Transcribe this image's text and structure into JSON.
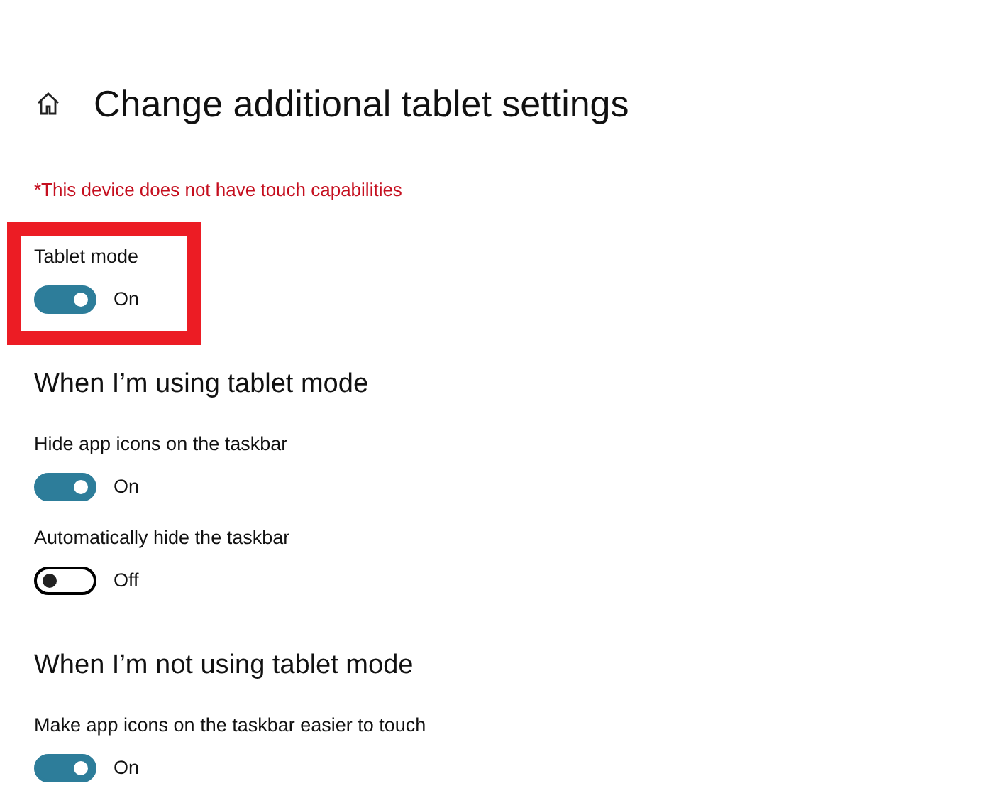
{
  "page": {
    "title": "Change additional tablet settings",
    "warning": "*This device does not have touch capabilities"
  },
  "sections": [
    {
      "settings": [
        {
          "label": "Tablet mode",
          "on": true,
          "state_text": "On",
          "highlighted": true
        }
      ]
    },
    {
      "heading": "When I’m using tablet mode",
      "settings": [
        {
          "label": "Hide app icons on the taskbar",
          "on": true,
          "state_text": "On",
          "highlighted": false
        },
        {
          "label": "Automatically hide the taskbar",
          "on": false,
          "state_text": "Off",
          "highlighted": false
        }
      ]
    },
    {
      "heading": "When I’m not using tablet mode",
      "settings": [
        {
          "label": "Make app icons on the taskbar easier to touch",
          "on": true,
          "state_text": "On",
          "highlighted": false
        }
      ]
    }
  ]
}
